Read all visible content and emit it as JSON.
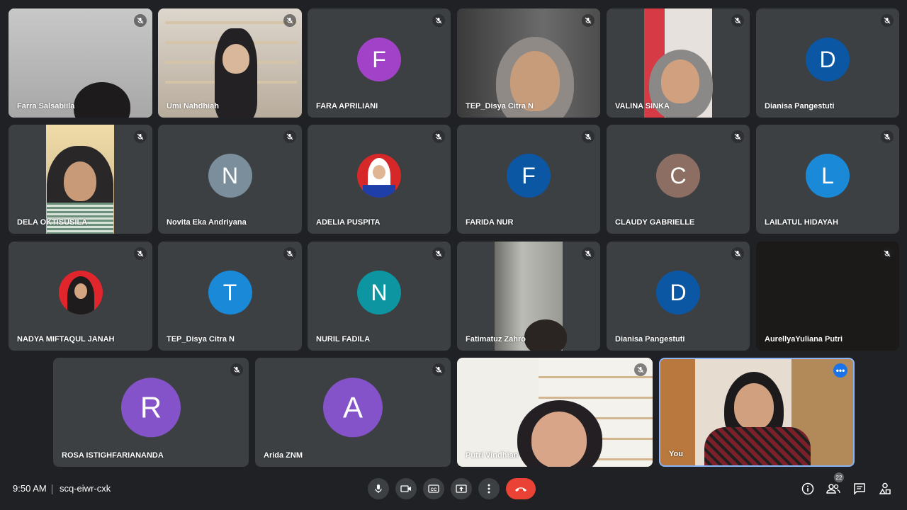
{
  "meeting": {
    "time": "9:50 AM",
    "code": "scq-eiwr-cxk",
    "participant_count": "22"
  },
  "participants": {
    "farra": "Farra Salsabiila",
    "umi": "Umi Nahdhiah",
    "fara": {
      "name": "FARA APRILIANI",
      "initial": "F"
    },
    "tep1": "TEP_Disya Citra N",
    "valina": "VALINA SINKA",
    "dianisa1": {
      "name": "Dianisa Pangestuti",
      "initial": "D"
    },
    "dela": "DELA OKTISUSILA",
    "novita": {
      "name": "Novita Eka Andriyana",
      "initial": "N"
    },
    "adelia": "ADELIA PUSPITA",
    "farida": {
      "name": "FARIDA NUR",
      "initial": "F"
    },
    "claudy": {
      "name": "CLAUDY GABRIELLE",
      "initial": "C"
    },
    "lailatul": {
      "name": "LAILATUL HIDAYAH",
      "initial": "L"
    },
    "nadya": "NADYA MIFTAQUL JANAH",
    "tep2": {
      "name": "TEP_Disya Citra N",
      "initial": "T"
    },
    "nuril": {
      "name": "NURIL FADILA",
      "initial": "N"
    },
    "fatimatuz": "Fatimatuz Zahro",
    "dianisa2": {
      "name": "Dianisa Pangestuti",
      "initial": "D"
    },
    "aurellya": "AurellyaYuliana Putri",
    "rosa": {
      "name": "ROSA ISTIGHFARIANANDA",
      "initial": "R"
    },
    "arida": {
      "name": "Arida ZNM",
      "initial": "A"
    },
    "putri": "Putri Vindhian",
    "you": "You"
  },
  "colors": {
    "tile_bg": "#3c4043",
    "purple": "#a142c8",
    "navy": "#0b57a4",
    "grey_blue": "#7a8f9b",
    "brown": "#8d6e63",
    "light_blue": "#1a8ad8",
    "teal": "#0e95a2",
    "violet": "#8553c9",
    "end_call": "#ea4335",
    "self_border": "#8ab4f8"
  }
}
